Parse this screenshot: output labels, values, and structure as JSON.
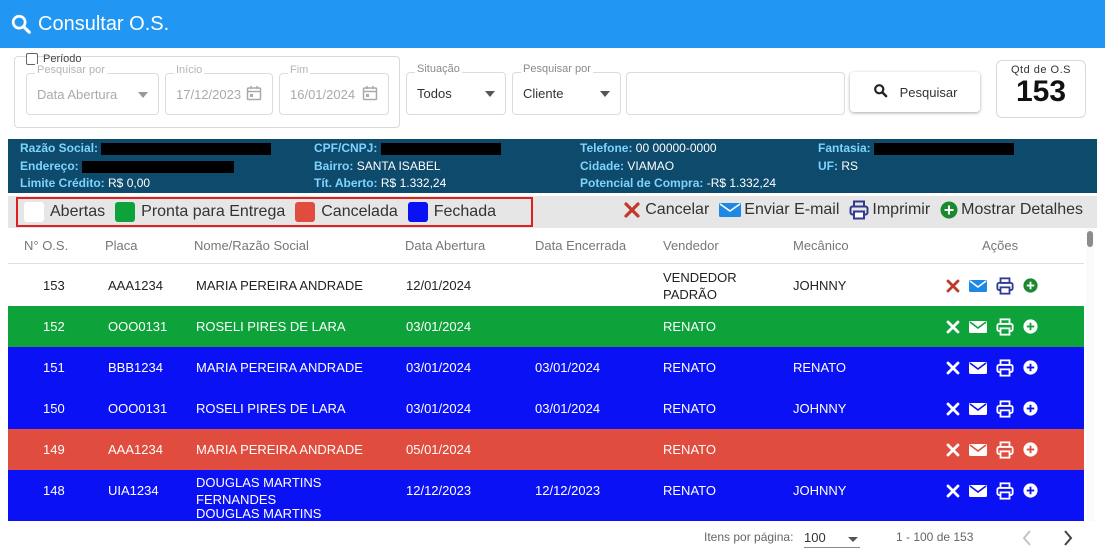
{
  "header": {
    "title": "Consultar O.S."
  },
  "filters": {
    "periodo_label": "Período",
    "pesquisar_por_label": "Pesquisar por",
    "pesquisar_por_value": "Data Abertura",
    "inicio_label": "Início",
    "inicio_value": "17/12/2023",
    "fim_label": "Fim",
    "fim_value": "16/01/2024",
    "situacao_label": "Situação",
    "situacao_value": "Todos",
    "pesquisar_por2_label": "Pesquisar por",
    "pesquisar_por2_value": "Cliente",
    "search_text": "",
    "search_button": "Pesquisar",
    "qtd_label": "Qtd de O.S",
    "qtd_value": "153"
  },
  "client": {
    "razao_label": "Razão Social:",
    "endereco_label": "Endereço:",
    "limite_label": "Limite Crédito:",
    "limite_value": "R$ 0,00",
    "cpf_label": "CPF/CNPJ:",
    "bairro_label": "Bairro:",
    "bairro_value": "SANTA ISABEL",
    "tit_label": "Tít. Aberto:",
    "tit_value": "R$ 1.332,24",
    "telefone_label": "Telefone:",
    "telefone_value": "00 00000-0000",
    "cidade_label": "Cidade:",
    "cidade_value": "VIAMAO",
    "potencial_label": "Potencial de Compra:",
    "potencial_value": "-R$ 1.332,24",
    "fantasia_label": "Fantasia:",
    "uf_label": "UF:",
    "uf_value": "RS"
  },
  "legend": {
    "abertas": "Abertas",
    "pronta": "Pronta para Entrega",
    "cancelada": "Cancelada",
    "fechada": "Fechada",
    "colors": {
      "abertas": "#ffffff",
      "pronta": "#0ea33a",
      "cancelada": "#e04c3d",
      "fechada": "#0a12f5"
    }
  },
  "toolbar": {
    "cancelar": "Cancelar",
    "enviar": "Enviar E-mail",
    "imprimir": "Imprimir",
    "mostrar": "Mostrar Detalhes"
  },
  "table": {
    "headers": {
      "num": "N° O.S.",
      "placa": "Placa",
      "nome": "Nome/Razão Social",
      "abertura": "Data Abertura",
      "encerrada": "Data Encerrada",
      "vendedor": "Vendedor",
      "mecanico": "Mecânico",
      "acoes": "Ações"
    },
    "rows": [
      {
        "num": "153",
        "placa": "AAA1234",
        "nome": "MARIA PEREIRA ANDRADE",
        "abertura": "12/01/2024",
        "encerrada": "",
        "vendedor": "VENDEDOR PADRÃO",
        "mecanico": "JOHNNY",
        "status": "abertas"
      },
      {
        "num": "152",
        "placa": "OOO0131",
        "nome": "ROSELI PIRES DE LARA",
        "abertura": "03/01/2024",
        "encerrada": "",
        "vendedor": "RENATO",
        "mecanico": "",
        "status": "pronta"
      },
      {
        "num": "151",
        "placa": "BBB1234",
        "nome": "MARIA PEREIRA ANDRADE",
        "abertura": "03/01/2024",
        "encerrada": "03/01/2024",
        "vendedor": "RENATO",
        "mecanico": "RENATO",
        "status": "fechada"
      },
      {
        "num": "150",
        "placa": "OOO0131",
        "nome": "ROSELI PIRES DE LARA",
        "abertura": "03/01/2024",
        "encerrada": "03/01/2024",
        "vendedor": "RENATO",
        "mecanico": "JOHNNY",
        "status": "fechada"
      },
      {
        "num": "149",
        "placa": "AAA1234",
        "nome": "MARIA PEREIRA ANDRADE",
        "abertura": "05/01/2024",
        "encerrada": "",
        "vendedor": "RENATO",
        "mecanico": "",
        "status": "cancelada"
      },
      {
        "num": "148",
        "placa": "UIA1234",
        "nome": "DOUGLAS MARTINS FERNANDES",
        "abertura": "12/12/2023",
        "encerrada": "12/12/2023",
        "vendedor": "RENATO",
        "mecanico": "JOHNNY",
        "status": "fechada"
      },
      {
        "num": "",
        "placa": "",
        "nome": "DOUGLAS MARTINS",
        "abertura": "",
        "encerrada": "",
        "vendedor": "",
        "mecanico": "",
        "status": "fechada"
      }
    ]
  },
  "pager": {
    "items_label": "Itens por página:",
    "items_value": "100",
    "range": "1 - 100 de 153"
  }
}
